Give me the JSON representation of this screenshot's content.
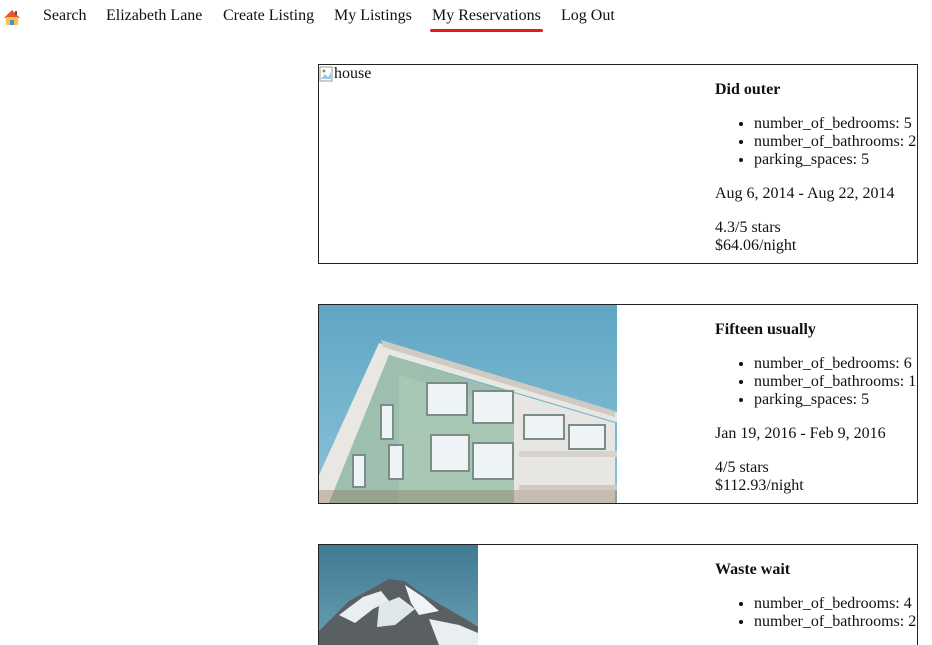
{
  "nav": {
    "home_icon": "house-icon",
    "items": [
      {
        "label": "Search"
      },
      {
        "label": "Elizabeth Lane"
      },
      {
        "label": "Create Listing"
      },
      {
        "label": "My Listings"
      },
      {
        "label": "My Reservations",
        "active": true
      },
      {
        "label": "Log Out"
      }
    ],
    "active_color": "#e31b1b"
  },
  "reservations": [
    {
      "image_alt": "house",
      "image_state": "broken",
      "title": "Did outer",
      "details": [
        "number_of_bedrooms: 5",
        "number_of_bathrooms: 2",
        "parking_spaces: 5"
      ],
      "dates": "Aug 6, 2014 - Aug 22, 2014",
      "rating": "4.3/5 stars",
      "price": "$64.06/night"
    },
    {
      "image_alt": "house",
      "image_state": "apartment-building-photo",
      "title": "Fifteen usually",
      "details": [
        "number_of_bedrooms: 6",
        "number_of_bathrooms: 1",
        "parking_spaces: 5"
      ],
      "dates": "Jan 19, 2016 - Feb 9, 2016",
      "rating": "4/5 stars",
      "price": "$112.93/night"
    },
    {
      "image_alt": "house",
      "image_state": "snowy-mountain-photo",
      "title": "Waste wait",
      "details": [
        "number_of_bedrooms: 4",
        "number_of_bathrooms: 2"
      ]
    }
  ]
}
